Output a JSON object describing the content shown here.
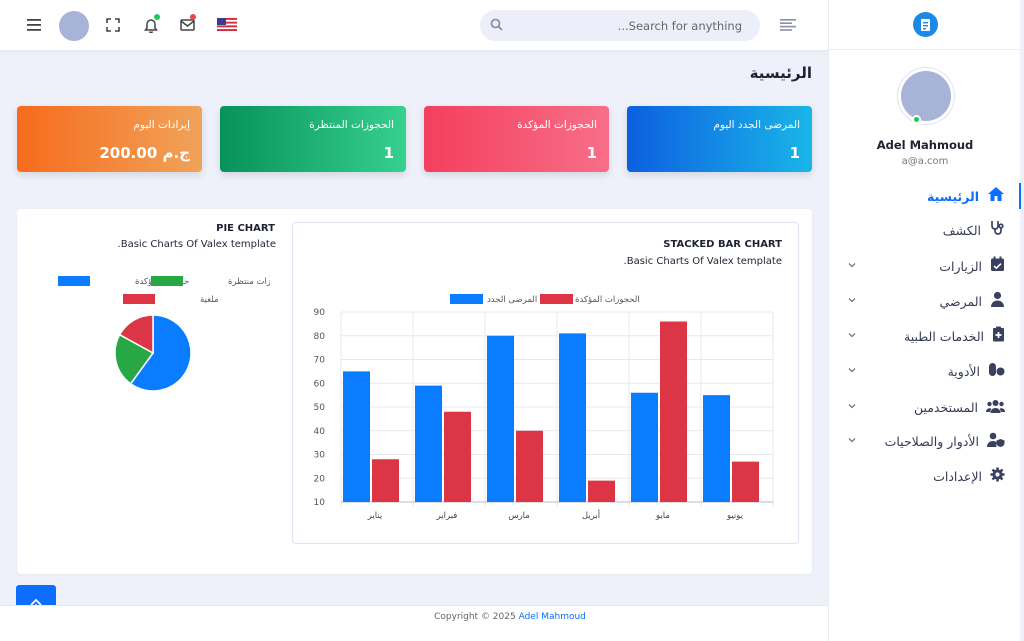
{
  "header": {
    "search_placeholder": "Search for anything...",
    "notification_dot_color": "#22c55e",
    "mail_dot_color": "#ef4444"
  },
  "sidebar": {
    "user_name": "Adel Mahmoud",
    "user_email": "a@a.com",
    "items": [
      {
        "label": "الرئيسية",
        "icon": "home-icon",
        "active": true,
        "has_children": false
      },
      {
        "label": "الكشف",
        "icon": "stethoscope-icon",
        "active": false,
        "has_children": false
      },
      {
        "label": "الزيارات",
        "icon": "calendar-check-icon",
        "active": false,
        "has_children": true
      },
      {
        "label": "المرضي",
        "icon": "user-doctor-icon",
        "active": false,
        "has_children": true
      },
      {
        "label": "الخدمات الطبية",
        "icon": "medical-file-icon",
        "active": false,
        "has_children": true
      },
      {
        "label": "الأدوية",
        "icon": "pills-icon",
        "active": false,
        "has_children": true
      },
      {
        "label": "المستخدمين",
        "icon": "users-icon",
        "active": false,
        "has_children": true
      },
      {
        "label": "الأدوار والصلاحيات",
        "icon": "user-shield-icon",
        "active": false,
        "has_children": true
      },
      {
        "label": "الإعدادات",
        "icon": "gear-icon",
        "active": false,
        "has_children": false
      }
    ]
  },
  "page": {
    "title": "الرئيسية"
  },
  "cards": [
    {
      "label": "المرضى الجدد اليوم",
      "value": "1",
      "color_from": "#0d5fe0",
      "color_to": "#19b6e8"
    },
    {
      "label": "الحجوزات المؤكدة",
      "value": "1",
      "color_from": "#f43f5e",
      "color_to": "#f76e88"
    },
    {
      "label": "الحجوزات المنتظرة",
      "value": "1",
      "color_from": "#07925a",
      "color_to": "#36d08f"
    },
    {
      "label": "إيرادات اليوم",
      "value": "200.00 ج.م",
      "color_from": "#f76b1c",
      "color_to": "#f0a35a"
    }
  ],
  "bar_chart": {
    "title": "STACKED BAR CHART",
    "subtitle": "Basic Charts Of Valex template.",
    "legend": [
      "المرضى الجدد",
      "الحجوزات المؤكدة"
    ]
  },
  "pie_chart": {
    "title": "PIE CHART",
    "subtitle": "Basic Charts Of Valex template.",
    "legend": [
      "حجوزات مؤكدة",
      "حجوزات منتظرة",
      "ملغية"
    ]
  },
  "chart_data": [
    {
      "type": "bar",
      "categories": [
        "يناير",
        "فبراير",
        "مارس",
        "أبريل",
        "مايو",
        "يونيو"
      ],
      "series": [
        {
          "name": "المرضى الجدد",
          "color": "#0a7cff",
          "values": [
            65,
            59,
            80,
            81,
            56,
            55
          ]
        },
        {
          "name": "الحجوزات المؤكدة",
          "color": "#dc3545",
          "values": [
            28,
            48,
            40,
            19,
            86,
            27
          ]
        }
      ],
      "ylim": [
        10,
        90
      ],
      "yticks": [
        10,
        20,
        30,
        40,
        50,
        60,
        70,
        80,
        90
      ],
      "grid": true,
      "legend_position": "top"
    },
    {
      "type": "pie",
      "categories": [
        "حجوزات مؤكدة",
        "حجوزات منتظرة",
        "ملغية"
      ],
      "colors": [
        "#0a7cff",
        "#28a745",
        "#dc3545"
      ],
      "values": [
        60,
        23,
        17
      ],
      "legend_position": "top"
    }
  ],
  "footer": {
    "copyright": "Copyright © 2025",
    "author": "Adel Mahmoud"
  }
}
